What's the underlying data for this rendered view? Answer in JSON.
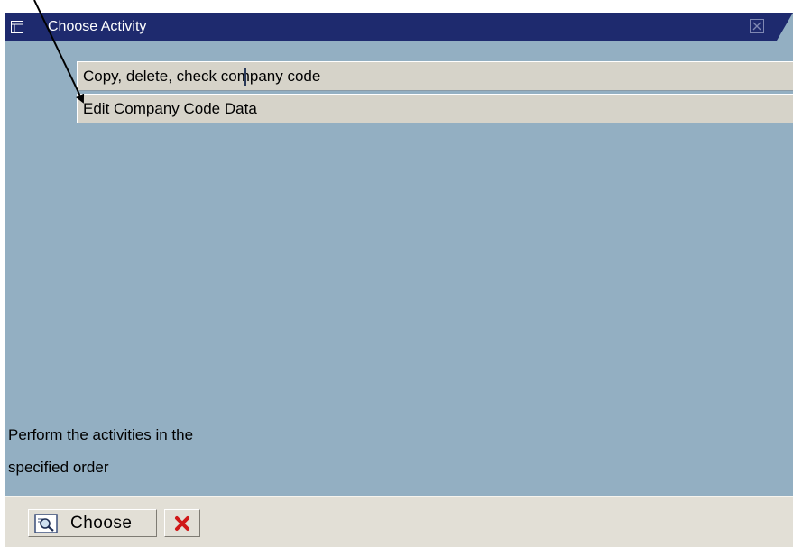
{
  "window": {
    "title": "Choose Activity",
    "title_icon": "dialog-icon",
    "close_icon": "close-icon"
  },
  "activities": [
    {
      "label": "Copy, delete, check company code"
    },
    {
      "label": "Edit Company Code Data"
    }
  ],
  "hint": {
    "line1": "Perform the activities in the",
    "line2": "specified order"
  },
  "footer": {
    "choose_label": "Choose",
    "choose_icon": "choose-magnifier-icon",
    "cancel_icon": "cancel-x-icon"
  },
  "colors": {
    "titlebar": "#1e2a6e",
    "background": "#93afc2",
    "list_item": "#d6d3c9",
    "footer": "#e2dfd6",
    "cancel_red": "#d01818"
  }
}
